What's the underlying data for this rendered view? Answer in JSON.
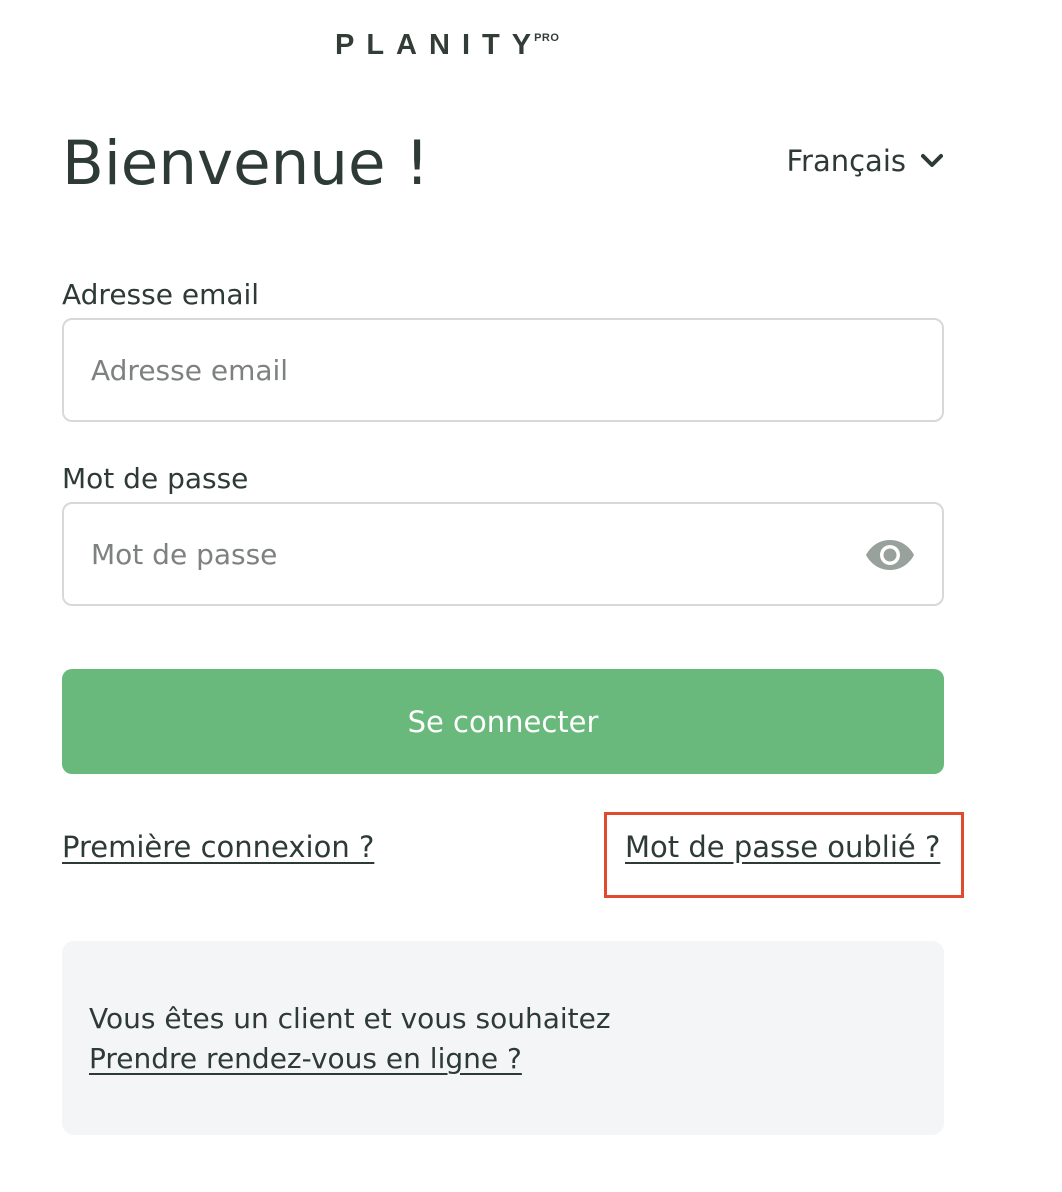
{
  "brand": {
    "name": "PLANITY",
    "badge": "PRO"
  },
  "title": "Bienvenue !",
  "language": {
    "selected": "Français",
    "icon": "chevron-down-icon"
  },
  "email": {
    "label": "Adresse email",
    "placeholder": "Adresse email",
    "value": ""
  },
  "password": {
    "label": "Mot de passe",
    "placeholder": "Mot de passe",
    "value": "",
    "toggle_icon": "eye-icon"
  },
  "login_button": "Se connecter",
  "links": {
    "first_login": "Première connexion ?",
    "forgot_password": "Mot de passe oublié ?"
  },
  "client_box": {
    "text": "Vous êtes un client et vous souhaitez",
    "link": "Prendre rendez-vous en ligne ?"
  },
  "colors": {
    "primary": "#68b97b",
    "text": "#2e3a35",
    "highlight": "#e04a2f",
    "client_bg": "#f4f5f7"
  }
}
